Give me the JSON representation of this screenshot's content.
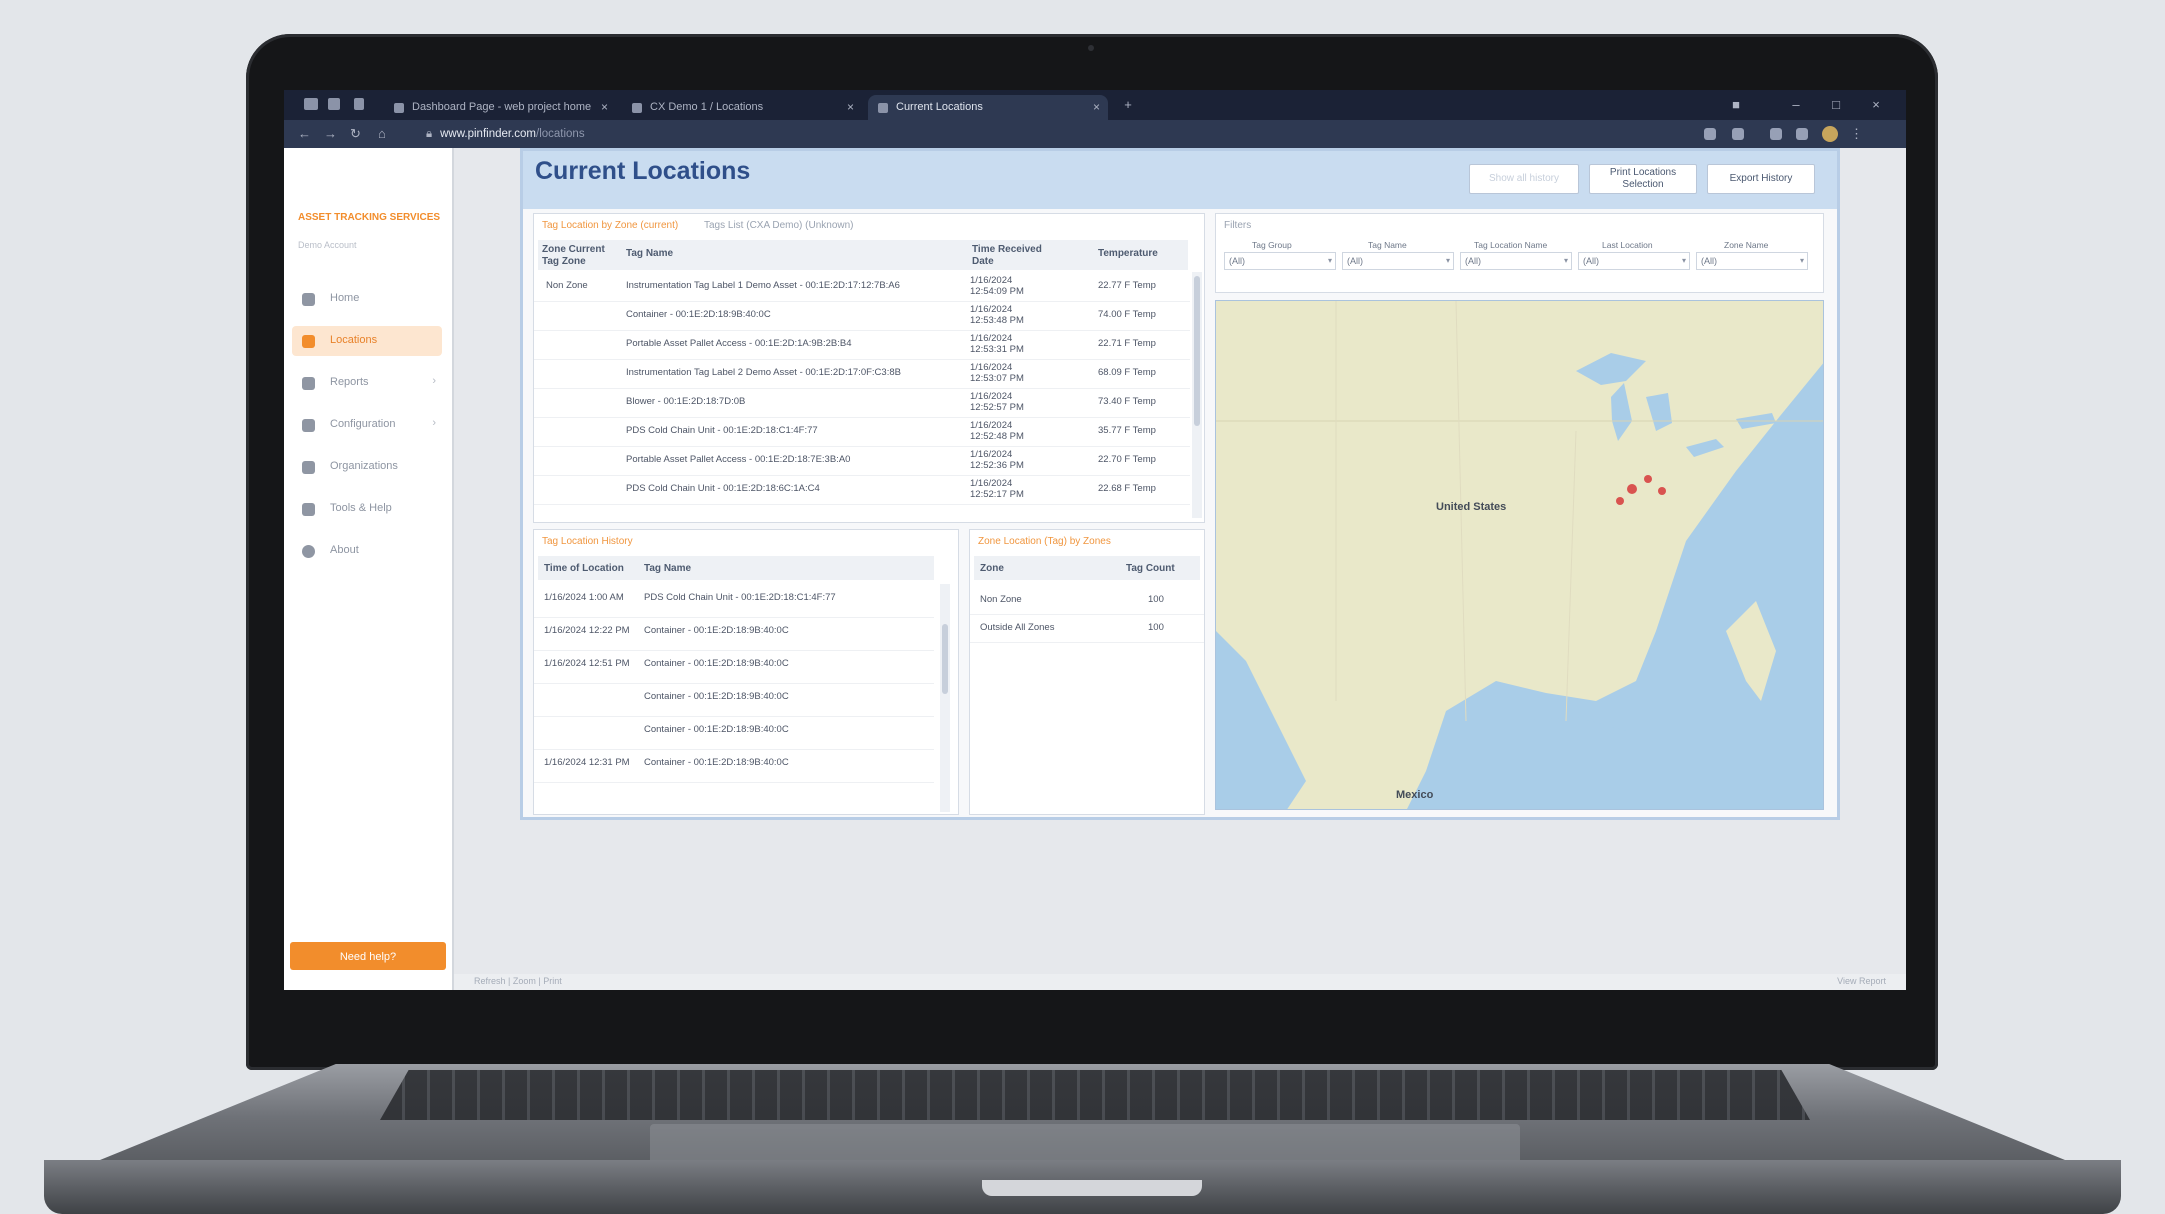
{
  "browser": {
    "tabs": [
      {
        "label": "Dashboard Page - web project home"
      },
      {
        "label": "CX Demo 1 / Locations"
      },
      {
        "label": "Current Locations"
      }
    ],
    "url_host": "www.pinfinder.com",
    "url_path": "/locations"
  },
  "sidebar": {
    "brand": "ASSET TRACKING SERVICES",
    "sub": "Demo Account",
    "items": [
      {
        "label": "Home",
        "icon": "home-icon"
      },
      {
        "label": "Locations",
        "icon": "pin-icon"
      },
      {
        "label": "Reports",
        "icon": "report-icon"
      },
      {
        "label": "Configuration",
        "icon": "gear-icon"
      },
      {
        "label": "Organizations",
        "icon": "building-icon"
      },
      {
        "label": "Tools & Help",
        "icon": "wrench-icon"
      },
      {
        "label": "About",
        "icon": "info-icon"
      }
    ],
    "help_button": "Need help?"
  },
  "page": {
    "title": "Current Locations",
    "buttons": {
      "ghost": "Show all history",
      "print": "Print Locations Selection",
      "export": "Export History"
    }
  },
  "tag_panel": {
    "links": [
      "Tag Location by Zone (current)",
      "Tags List (CXA Demo) (Unknown)"
    ],
    "headers": {
      "zone": "Zone Current Tag Zone",
      "tag": "Tag Name",
      "time": "Time Received Date",
      "temp": "Temperature"
    },
    "rows": [
      {
        "zone": "Non Zone",
        "tag": "Instrumentation Tag Label 1 Demo Asset - 00:1E:2D:17:12:7B:A6",
        "time1": "1/16/2024",
        "time2": "12:54:09 PM",
        "temp": "22.77 F Temp"
      },
      {
        "zone": "",
        "tag": "Container - 00:1E:2D:18:9B:40:0C",
        "time1": "1/16/2024",
        "time2": "12:53:48 PM",
        "temp": "74.00 F Temp"
      },
      {
        "zone": "",
        "tag": "Portable Asset Pallet Access - 00:1E:2D:1A:9B:2B:B4",
        "time1": "1/16/2024",
        "time2": "12:53:31 PM",
        "temp": "22.71 F Temp"
      },
      {
        "zone": "",
        "tag": "Instrumentation Tag Label 2 Demo Asset - 00:1E:2D:17:0F:C3:8B",
        "time1": "1/16/2024",
        "time2": "12:53:07 PM",
        "temp": "68.09 F Temp"
      },
      {
        "zone": "",
        "tag": "Blower - 00:1E:2D:18:7D:0B",
        "time1": "1/16/2024",
        "time2": "12:52:57 PM",
        "temp": "73.40 F Temp"
      },
      {
        "zone": "",
        "tag": "PDS Cold Chain Unit - 00:1E:2D:18:C1:4F:77",
        "time1": "1/16/2024",
        "time2": "12:52:48 PM",
        "temp": "35.77 F Temp"
      },
      {
        "zone": "",
        "tag": "Portable Asset Pallet Access - 00:1E:2D:18:7E:3B:A0",
        "time1": "1/16/2024",
        "time2": "12:52:36 PM",
        "temp": "22.70 F Temp"
      },
      {
        "zone": "",
        "tag": "PDS Cold Chain Unit - 00:1E:2D:18:6C:1A:C4",
        "time1": "1/16/2024",
        "time2": "12:52:17 PM",
        "temp": "22.68 F Temp"
      }
    ]
  },
  "history_panel": {
    "link": "Tag Location History",
    "headers": {
      "time": "Time of Location",
      "tag": "Tag Name"
    },
    "rows": [
      {
        "time": "1/16/2024 1:00 AM",
        "tag": "PDS Cold Chain Unit - 00:1E:2D:18:C1:4F:77"
      },
      {
        "time": "1/16/2024 12:22 PM",
        "tag": "Container - 00:1E:2D:18:9B:40:0C"
      },
      {
        "time": "1/16/2024 12:51 PM",
        "tag": "Container - 00:1E:2D:18:9B:40:0C"
      },
      {
        "time": "",
        "tag": "Container - 00:1E:2D:18:9B:40:0C"
      },
      {
        "time": "",
        "tag": "Container - 00:1E:2D:18:9B:40:0C"
      },
      {
        "time": "1/16/2024 12:31 PM",
        "tag": "Container - 00:1E:2D:18:9B:40:0C"
      }
    ]
  },
  "zone_panel": {
    "link": "Zone Location (Tag) by Zones",
    "headers": {
      "zone": "Zone",
      "count": "Tag Count"
    },
    "rows": [
      {
        "zone": "Non Zone",
        "count": "100"
      },
      {
        "zone": "Outside All Zones",
        "count": "100"
      }
    ]
  },
  "filters": {
    "title": "Filters",
    "fields": [
      {
        "label": "Tag Group",
        "value": "(All)"
      },
      {
        "label": "Tag Name",
        "value": "(All)"
      },
      {
        "label": "Tag Location Name",
        "value": "(All)"
      },
      {
        "label": "Last Location",
        "value": "(All)"
      },
      {
        "label": "Zone Name",
        "value": "(All)"
      }
    ]
  },
  "map": {
    "labels": {
      "us": "United States",
      "mexico": "Mexico"
    }
  },
  "statusbar": {
    "left": "Refresh  |  Zoom  |  Print",
    "right": "View Report"
  }
}
